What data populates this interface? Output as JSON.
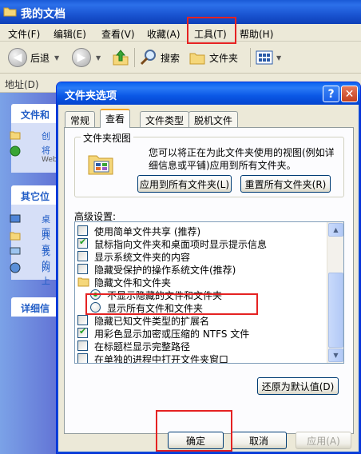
{
  "explorer": {
    "title": "我的文档",
    "menu": [
      {
        "label": "文件(F)"
      },
      {
        "label": "编辑(E)"
      },
      {
        "label": "查看(V)"
      },
      {
        "label": "收藏(A)"
      },
      {
        "label": "工具(T)"
      },
      {
        "label": "帮助(H)"
      }
    ],
    "toolbar": {
      "back": "后退",
      "search": "搜索",
      "folders": "文件夹"
    },
    "address_label": "地址(D)",
    "tasks": {
      "file_head": "文件和",
      "file_items": [
        "创",
        "将",
        "Web"
      ],
      "other_head": "其它位",
      "other_items": [
        "桌面",
        "共享",
        "我的",
        "网上"
      ],
      "details_head": "详细信"
    }
  },
  "dialog": {
    "title": "文件夹选项",
    "help": "?",
    "close": "✕",
    "tabs": [
      "常规",
      "查看",
      "文件类型",
      "脱机文件"
    ],
    "active_tab": "查看",
    "folder_view": {
      "title": "文件夹视图",
      "description": "您可以将正在为此文件夹使用的视图(例如详细信息或平铺)应用到所有文件夹。",
      "apply_all": "应用到所有文件夹(L)",
      "reset_all": "重置所有文件夹(R)"
    },
    "advanced_label": "高级设置:",
    "advanced_items": [
      {
        "type": "checkbox",
        "checked": false,
        "label": "使用简单文件共享 (推荐)"
      },
      {
        "type": "checkbox",
        "checked": true,
        "label": "鼠标指向文件夹和桌面项时显示提示信息"
      },
      {
        "type": "checkbox",
        "checked": false,
        "label": "显示系统文件夹的内容"
      },
      {
        "type": "checkbox",
        "checked": false,
        "label": "隐藏受保护的操作系统文件(推荐)"
      },
      {
        "type": "folder",
        "checked": false,
        "label": "隐藏文件和文件夹"
      },
      {
        "type": "radio",
        "checked": true,
        "label": "不显示隐藏的文件和文件夹"
      },
      {
        "type": "radio",
        "checked": false,
        "label": "显示所有文件和文件夹"
      },
      {
        "type": "checkbox",
        "checked": false,
        "label": "隐藏已知文件类型的扩展名"
      },
      {
        "type": "checkbox",
        "checked": true,
        "label": "用彩色显示加密或压缩的 NTFS 文件"
      },
      {
        "type": "checkbox",
        "checked": false,
        "label": "在标题栏显示完整路径"
      },
      {
        "type": "checkbox",
        "checked": false,
        "label": "在单独的进程中打开文件夹窗口"
      }
    ],
    "restore_defaults": "还原为默认值(D)",
    "ok": "确定",
    "cancel": "取消",
    "apply": "应用(A)"
  },
  "colors": {
    "annotation": "#e52222",
    "titlebar": "#0a62f0"
  }
}
